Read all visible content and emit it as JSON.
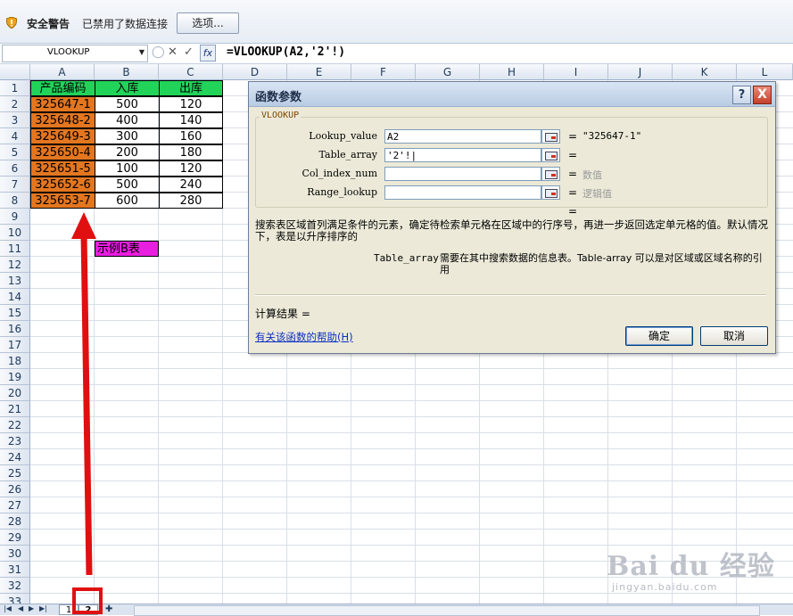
{
  "security_bar": {
    "title": "安全警告",
    "message": "已禁用了数据连接",
    "options_button": "选项..."
  },
  "formula_bar": {
    "name_box": "VLOOKUP",
    "formula": "=VLOOKUP(A2,'2'!)",
    "fx_label": "fx"
  },
  "grid": {
    "column_headers": [
      "A",
      "B",
      "C",
      "D",
      "E",
      "F",
      "G",
      "H",
      "I",
      "J",
      "K",
      "L"
    ],
    "row_headers": [
      "1",
      "2",
      "3",
      "4",
      "5",
      "6",
      "7",
      "8",
      "9",
      "10",
      "11",
      "12",
      "13",
      "14",
      "15",
      "16",
      "17",
      "18",
      "19",
      "20",
      "21",
      "22",
      "23",
      "24",
      "25",
      "26",
      "27",
      "28",
      "29",
      "30",
      "31",
      "32",
      "33"
    ],
    "table_headers": [
      "产品编码",
      "入库",
      "出库"
    ],
    "rows": [
      [
        "325647-1",
        "500",
        "120"
      ],
      [
        "325648-2",
        "400",
        "140"
      ],
      [
        "325649-3",
        "300",
        "160"
      ],
      [
        "325650-4",
        "200",
        "180"
      ],
      [
        "325651-5",
        "100",
        "120"
      ],
      [
        "325652-6",
        "500",
        "240"
      ],
      [
        "325653-7",
        "600",
        "280"
      ]
    ],
    "b11_label": "示例B表"
  },
  "colors": {
    "header_green": "#22d35a",
    "code_orange": "#e3761f",
    "label_magenta": "#e81ee0",
    "annotation_red": "#e01010"
  },
  "dialog": {
    "title": "函数参数",
    "help_q": "?",
    "close_x": "X",
    "group_title": "VLOOKUP",
    "args": [
      {
        "label": "Lookup_value",
        "value": "A2",
        "result": "\"325647-1\""
      },
      {
        "label": "Table_array",
        "value": "'2'!|",
        "result": ""
      },
      {
        "label": "Col_index_num",
        "value": "",
        "result": "数值"
      },
      {
        "label": "Range_lookup",
        "value": "",
        "result": "逻辑值"
      }
    ],
    "equals": "=",
    "description": "搜索表区域首列满足条件的元素，确定待检索单元格在区域中的行序号，再进一步返回选定单元格的值。默认情况下，表是以升序排序的",
    "arg_name": "Table_array",
    "arg_description": "需要在其中搜索数据的信息表。Table-array 可以是对区域或区域名称的引用",
    "calc_result": "计算结果 =",
    "help_link": "有关该函数的帮助(H)",
    "ok": "确定",
    "cancel": "取消"
  },
  "sheet_tabs": [
    "1",
    "2"
  ],
  "watermark": {
    "big": "Bai du 经验",
    "small": "jingyan.baidu.com"
  }
}
